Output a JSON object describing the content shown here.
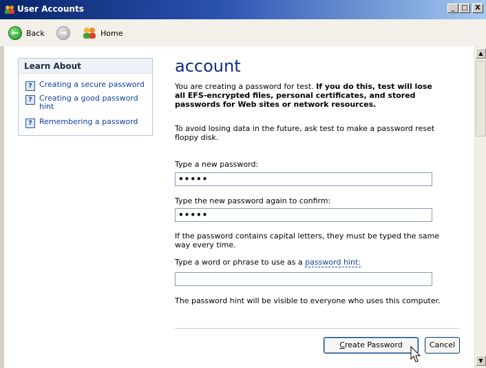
{
  "window": {
    "title": "User Accounts",
    "min_glyph": "_",
    "max_glyph": "□",
    "close_glyph": "X"
  },
  "nav": {
    "back_label": "Back",
    "home_label": "Home"
  },
  "sidebar": {
    "heading": "Learn About",
    "items": [
      {
        "label": "Creating a secure password"
      },
      {
        "label": "Creating a good password hint"
      },
      {
        "label": "Remembering a password"
      }
    ]
  },
  "main": {
    "title": "account",
    "warning_intro": "You are creating a password for test. ",
    "warning_bold": "If you do this, test will lose all EFS-encrypted files, personal certificates, and stored passwords for Web sites or network resources.",
    "reset_tip": "To avoid losing data in the future, ask test to make a password reset floppy disk.",
    "new_password_label": "Type a new password:",
    "new_password_value": "•••••",
    "confirm_label": "Type the new password again to confirm:",
    "confirm_value": "•••••",
    "caps_note": "If the password contains capital letters, they must be typed the same way every time.",
    "hint_label_prefix": "Type a word or phrase to use as a ",
    "hint_link": "password hint:",
    "hint_value": "",
    "hint_note": "The password hint will be visible to everyone who uses this computer."
  },
  "buttons": {
    "create_first": "C",
    "create_rest": "reate Password",
    "cancel": "Cancel"
  },
  "colors": {
    "title_gradient_start": "#0a246a",
    "link": "#0b3ea3",
    "heading_blue": "#0b2d8a"
  }
}
